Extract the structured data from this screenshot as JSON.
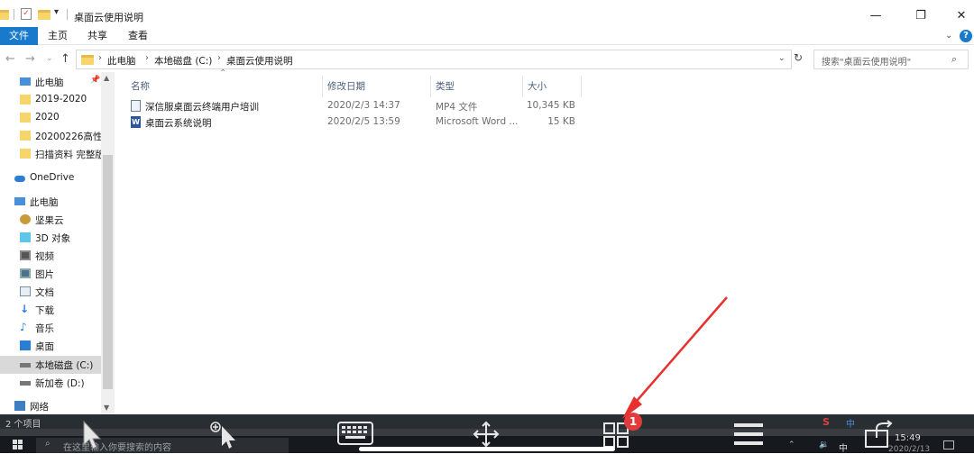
{
  "window": {
    "title": "桌面云使用说明",
    "controls": {
      "minimize": "—",
      "maximize": "❐",
      "close": "✕"
    }
  },
  "ribbon": {
    "tabs": [
      "文件",
      "主页",
      "共享",
      "查看"
    ],
    "help": "?"
  },
  "address": {
    "crumbs": [
      "此电脑",
      "本地磁盘 (C:)",
      "桌面云使用说明"
    ],
    "search_placeholder": "搜索\"桌面云使用说明\""
  },
  "sidebar": {
    "items": [
      {
        "label": "此电脑",
        "icon": "pc-icon",
        "pinned": true
      },
      {
        "label": "2019-2020",
        "icon": "folder-icon"
      },
      {
        "label": "2020",
        "icon": "folder-icon"
      },
      {
        "label": "20200226高性能",
        "icon": "folder-icon"
      },
      {
        "label": "扫描资料 完整版",
        "icon": "folder-icon"
      },
      {
        "label": "OneDrive",
        "icon": "cloud-icon"
      },
      {
        "label": "此电脑",
        "icon": "pc-icon"
      },
      {
        "label": "坚果云",
        "icon": "nut-icon"
      },
      {
        "label": "3D 对象",
        "icon": "cube-icon"
      },
      {
        "label": "视频",
        "icon": "video-icon"
      },
      {
        "label": "图片",
        "icon": "image-icon"
      },
      {
        "label": "文档",
        "icon": "document-icon"
      },
      {
        "label": "下载",
        "icon": "download-icon"
      },
      {
        "label": "音乐",
        "icon": "music-icon"
      },
      {
        "label": "桌面",
        "icon": "desktop-icon"
      },
      {
        "label": "本地磁盘 (C:)",
        "icon": "drive-icon",
        "selected": true
      },
      {
        "label": "新加卷 (D:)",
        "icon": "drive-icon"
      },
      {
        "label": "网络",
        "icon": "network-icon"
      }
    ]
  },
  "filelist": {
    "columns": [
      "名称",
      "修改日期",
      "类型",
      "大小"
    ],
    "rows": [
      {
        "name": "深信服桌面云终端用户培训",
        "date": "2020/2/3 14:37",
        "type": "MP4 文件",
        "size": "10,345 KB",
        "icon": "video-file-icon"
      },
      {
        "name": "桌面云系统说明",
        "date": "2020/2/5 13:59",
        "type": "Microsoft Word ...",
        "size": "15 KB",
        "icon": "word-file-icon"
      }
    ]
  },
  "status": {
    "text": "2 个项目"
  },
  "taskbar": {
    "search_placeholder": "在这里输入你要搜索的内容",
    "clock": "15:49",
    "date": "2020/2/13",
    "ime": "中"
  },
  "toolbar": {
    "badge": "1"
  },
  "colors": {
    "accent": "#1979ca",
    "arrow": "#e8302f",
    "toolbar": "#2c3035"
  }
}
